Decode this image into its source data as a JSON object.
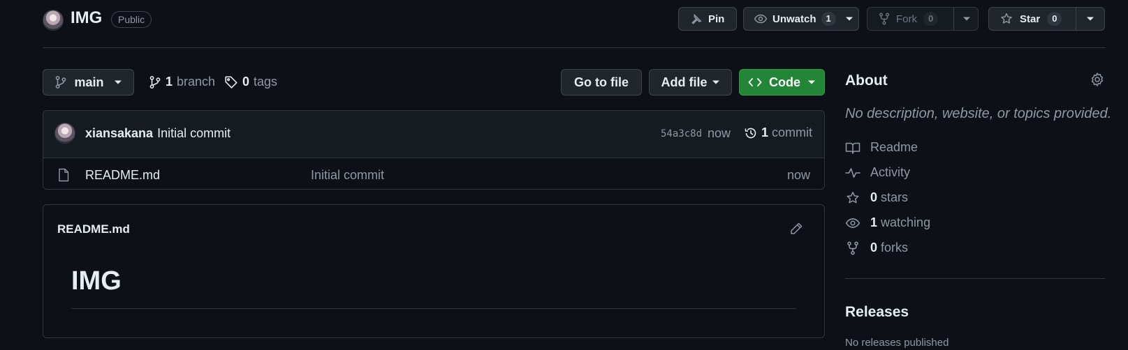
{
  "header": {
    "repo_name": "IMG",
    "visibility": "Public",
    "pin_label": "Pin",
    "unwatch_label": "Unwatch",
    "unwatch_count": "1",
    "fork_label": "Fork",
    "fork_count": "0",
    "star_label": "Star",
    "star_count": "0"
  },
  "toolbar": {
    "branch_name": "main",
    "branch_count": "1",
    "branch_label": "branch",
    "tag_count": "0",
    "tag_label": "tags",
    "goto_file_label": "Go to file",
    "add_file_label": "Add file",
    "code_label": "Code"
  },
  "latest_commit": {
    "author": "xiansakana",
    "message": "Initial commit",
    "sha": "54a3c8d",
    "time": "now",
    "commit_count": "1",
    "commit_label": "commit"
  },
  "files": [
    {
      "name": "README.md",
      "message": "Initial commit",
      "time": "now"
    }
  ],
  "readme": {
    "filename": "README.md",
    "heading": "IMG"
  },
  "sidebar": {
    "about_title": "About",
    "description": "No description, website, or topics provided.",
    "readme_label": "Readme",
    "activity_label": "Activity",
    "stars_count": "0",
    "stars_label": "stars",
    "watching_count": "1",
    "watching_label": "watching",
    "forks_count": "0",
    "forks_label": "forks",
    "releases_title": "Releases",
    "releases_text": "No releases published"
  },
  "colors": {
    "background": "#0d1117",
    "border": "#30363d",
    "button_bg": "#21262d",
    "code_button": "#238636",
    "muted_text": "#9198a1",
    "text": "#e6edf3"
  },
  "icons": [
    "avatar",
    "pin-icon",
    "eye-icon",
    "fork-icon",
    "star-icon",
    "chevron-down-icon",
    "branch-icon",
    "tag-icon",
    "code-icon",
    "history-icon",
    "file-icon",
    "pencil-icon",
    "gear-icon",
    "book-icon",
    "pulse-icon"
  ]
}
